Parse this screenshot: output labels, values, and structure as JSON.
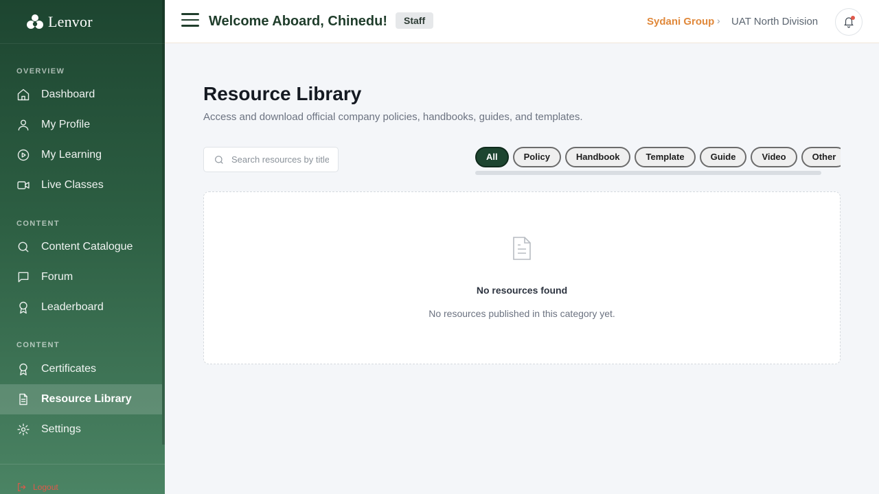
{
  "brand": {
    "name": "Lenvor"
  },
  "sidebar": {
    "sections": [
      {
        "label": "OVERVIEW"
      },
      {
        "label": "CONTENT"
      },
      {
        "label": "CONTENT"
      }
    ],
    "items": [
      {
        "label": "Dashboard",
        "icon": "home-icon"
      },
      {
        "label": "My Profile",
        "icon": "user-icon"
      },
      {
        "label": "My Learning",
        "icon": "play-circle-icon"
      },
      {
        "label": "Live Classes",
        "icon": "video-icon"
      },
      {
        "label": "Content Catalogue",
        "icon": "search-icon"
      },
      {
        "label": "Forum",
        "icon": "chat-icon"
      },
      {
        "label": "Leaderboard",
        "icon": "award-icon"
      },
      {
        "label": "Certificates",
        "icon": "award-icon"
      },
      {
        "label": "Resource Library",
        "icon": "document-icon",
        "active": true
      },
      {
        "label": "Settings",
        "icon": "gear-icon"
      }
    ],
    "logout_label": "Logout"
  },
  "header": {
    "welcome": "Welcome Aboard, Chinedu!",
    "role_badge": "Staff",
    "breadcrumb": {
      "org": "Sydani Group",
      "division": "UAT North Division"
    }
  },
  "main": {
    "title": "Resource Library",
    "subtitle": "Access and download official company policies, handbooks, guides, and templates.",
    "search": {
      "placeholder": "Search resources by title...",
      "value": ""
    },
    "filters": [
      {
        "label": "All",
        "active": true
      },
      {
        "label": "Policy"
      },
      {
        "label": "Handbook"
      },
      {
        "label": "Template"
      },
      {
        "label": "Guide"
      },
      {
        "label": "Video"
      },
      {
        "label": "Other"
      }
    ],
    "empty_state": {
      "title": "No resources found",
      "message": "No resources published in this category yet."
    }
  },
  "colors": {
    "sidebar_dark": "#1d4530",
    "sidebar_light": "#4b8464",
    "accent_orange": "#e0883a",
    "title_green": "#1f3d2b",
    "danger": "#e0584a"
  }
}
